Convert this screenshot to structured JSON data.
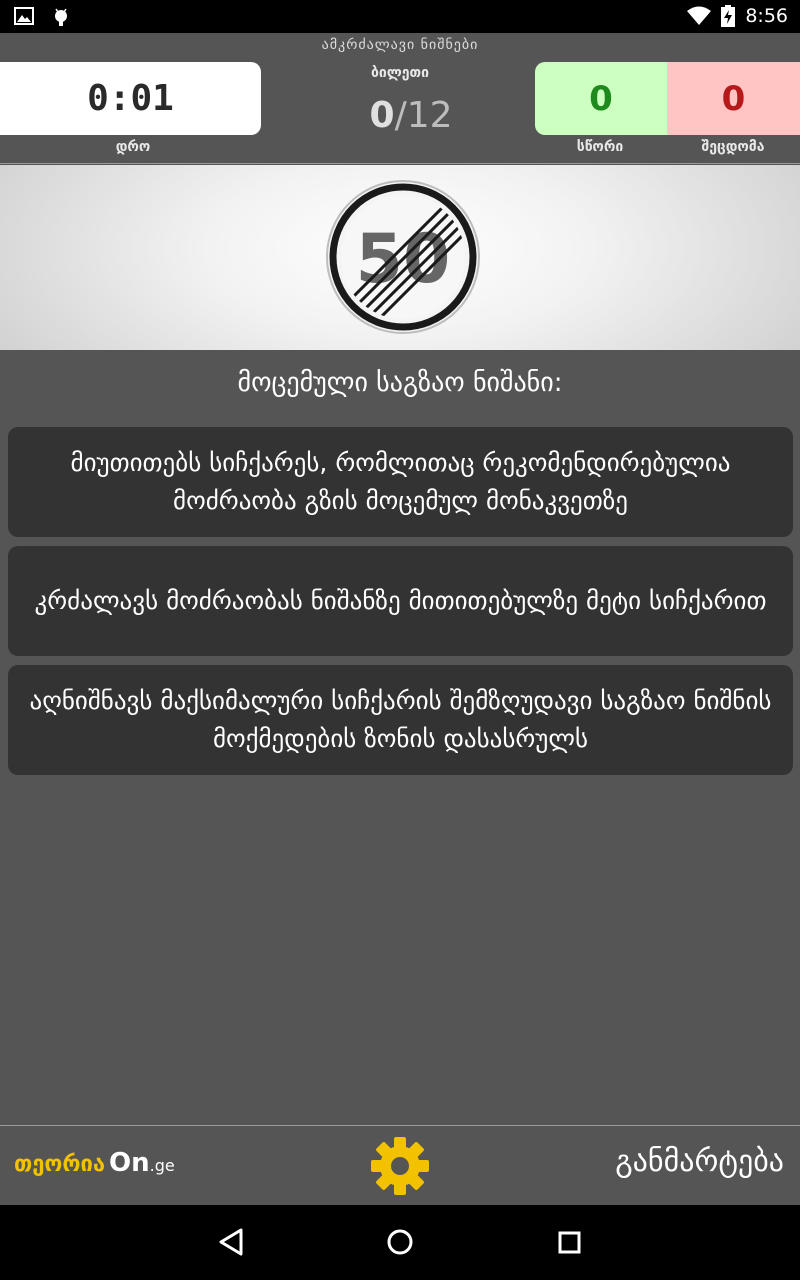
{
  "status_bar": {
    "time": "8:56",
    "icons": [
      "image-icon",
      "android-icon",
      "wifi-icon",
      "battery-charging-icon"
    ]
  },
  "header": {
    "category_title": "ამკრძალავი ნიშნები",
    "timer": {
      "value": "0:01",
      "label": "დრო"
    },
    "ticket": {
      "label": "ბილეთი",
      "current": "0",
      "total": "/12"
    },
    "correct": {
      "value": "0",
      "label": "სწორი",
      "color": "#1e8a1e",
      "bg": "#ccffc0"
    },
    "wrong": {
      "value": "0",
      "label": "შეცდომა",
      "color": "#b51a1a",
      "bg": "#ffc4c4"
    }
  },
  "sign": {
    "name": "end-of-speed-limit-50-sign",
    "number": "50"
  },
  "question": "მოცემული საგზაო ნიშანი:",
  "answers": [
    {
      "text": "მიუთითებს სიჩქარეს, რომლითაც რეკომენდირებულია მოძრაობა გზის მოცემულ მონაკვეთზე"
    },
    {
      "text": "კრძალავს მოძრაობას ნიშანზე მითითებულზე მეტი სიჩქარით"
    },
    {
      "text": "აღნიშნავს მაქსიმალური სიჩქარის შემზღუდავი საგზაო ნიშნის მოქმედების ზონის დასასრულს"
    }
  ],
  "toolbar": {
    "logo_georgian": "თეორია",
    "logo_on": "On",
    "logo_domain": ".ge",
    "settings_icon": "gear-icon",
    "explanation_label": "განმარტება"
  },
  "nav": {
    "back": "back-icon",
    "home": "home-icon",
    "recents": "recents-icon"
  }
}
